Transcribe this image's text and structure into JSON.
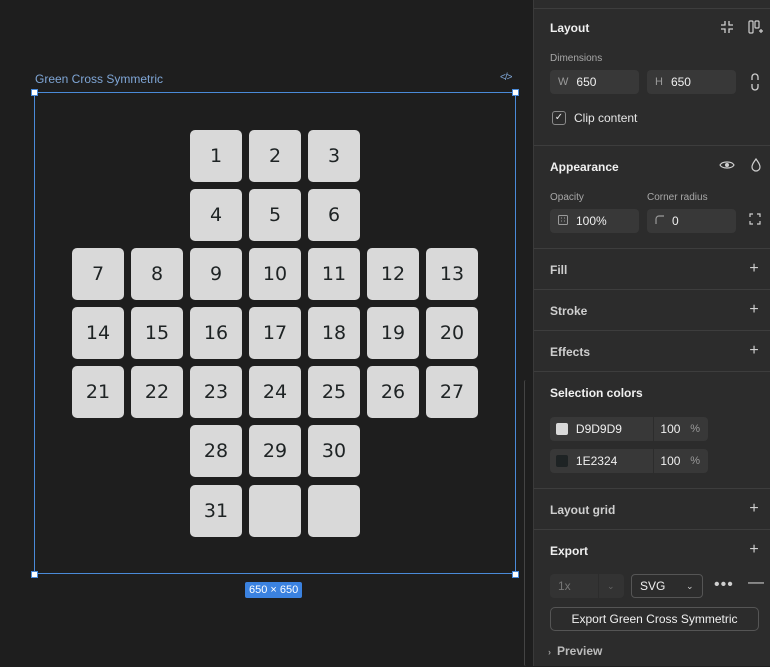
{
  "canvas": {
    "frame_name": "Green Cross Symmetric",
    "size_badge": "650 × 650",
    "tile_color": "#D9D9D9",
    "text_color": "#1E2324",
    "tiles": [
      "1",
      "2",
      "3",
      "4",
      "5",
      "6",
      "7",
      "8",
      "9",
      "10",
      "11",
      "12",
      "13",
      "14",
      "15",
      "16",
      "17",
      "18",
      "19",
      "20",
      "21",
      "22",
      "23",
      "24",
      "25",
      "26",
      "27",
      "28",
      "29",
      "30",
      "31",
      "",
      ""
    ]
  },
  "panel": {
    "layout": {
      "title": "Layout",
      "dimensions_label": "Dimensions",
      "w_prefix": "W",
      "w_value": "650",
      "h_prefix": "H",
      "h_value": "650",
      "clip_label": "Clip content",
      "clip_checked": true
    },
    "appearance": {
      "title": "Appearance",
      "opacity_label": "Opacity",
      "opacity_value": "100%",
      "radius_label": "Corner radius",
      "radius_value": "0"
    },
    "fill": {
      "title": "Fill"
    },
    "stroke": {
      "title": "Stroke"
    },
    "effects": {
      "title": "Effects"
    },
    "selection_colors": {
      "title": "Selection colors",
      "colors": [
        {
          "hex": "D9D9D9",
          "opacity": "100",
          "unit": "%",
          "swatch": "#D9D9D9"
        },
        {
          "hex": "1E2324",
          "opacity": "100",
          "unit": "%",
          "swatch": "#1E2324"
        }
      ]
    },
    "layout_grid": {
      "title": "Layout grid"
    },
    "export": {
      "title": "Export",
      "scale": "1x",
      "format": "SVG",
      "export_button": "Export Green Cross Symmetric",
      "preview_label": "Preview"
    }
  }
}
